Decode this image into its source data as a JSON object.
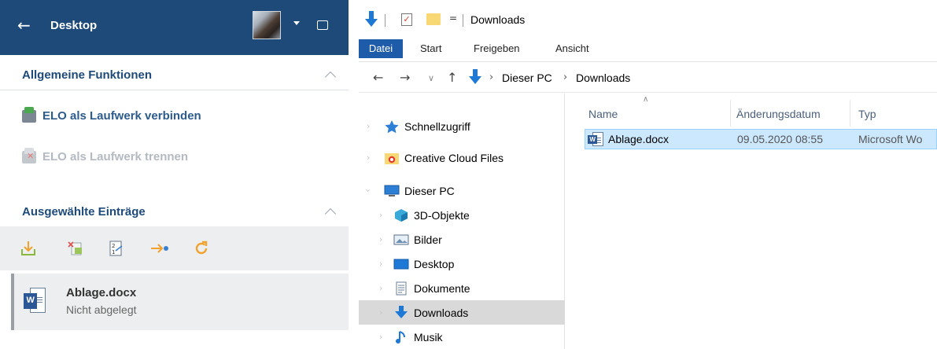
{
  "left_panel": {
    "header": {
      "back_glyph": "←",
      "title": "Desktop"
    },
    "sections": {
      "general": {
        "title": "Allgemeine Funktionen"
      },
      "selected": {
        "title": "Ausgewählte Einträge"
      }
    },
    "functions": [
      {
        "label": "ELO als Laufwerk verbinden",
        "enabled": true,
        "icon": "network-drive-connect-icon"
      },
      {
        "label": "ELO als Laufwerk trennen",
        "enabled": false,
        "icon": "network-drive-disconnect-icon"
      }
    ],
    "toolbar_icons": [
      "store-download-icon",
      "delete-entry-icon",
      "version-compare-icon",
      "move-arrow-icon",
      "refresh-icon"
    ],
    "entry": {
      "name": "Ablage.docx",
      "status": "Nicht abgelegt",
      "icon": "word-doc-icon"
    },
    "colors": {
      "header_bg": "#1e4a7a",
      "accent": "#2c5b8c"
    }
  },
  "explorer": {
    "window_title": "Downloads",
    "quick_access_dropdown": "=",
    "ribbon_tabs": [
      "Datei",
      "Start",
      "Freigeben",
      "Ansicht"
    ],
    "breadcrumb": [
      "Dieser PC",
      "Downloads"
    ],
    "nav_items": [
      {
        "label": "Schnellzugriff",
        "icon": "star-icon"
      },
      {
        "label": "Creative Cloud Files",
        "icon": "creative-cloud-folder-icon"
      },
      {
        "label": "Dieser PC",
        "icon": "computer-icon"
      },
      {
        "label": "3D-Objekte",
        "icon": "3d-objects-icon"
      },
      {
        "label": "Bilder",
        "icon": "pictures-icon"
      },
      {
        "label": "Desktop",
        "icon": "desktop-folder-icon"
      },
      {
        "label": "Dokumente",
        "icon": "documents-icon"
      },
      {
        "label": "Downloads",
        "icon": "downloads-icon",
        "selected": true
      },
      {
        "label": "Musik",
        "icon": "music-icon"
      }
    ],
    "columns": {
      "name": "Name",
      "date": "Änderungsdatum",
      "type": "Typ"
    },
    "files": [
      {
        "name": "Ablage.docx",
        "date": "09.05.2020 08:55",
        "type": "Microsoft Wo"
      }
    ],
    "colors": {
      "file_tab": "#1e5ba8",
      "selected_row": "#cce8ff",
      "nav_selected": "#d9d9d9"
    }
  }
}
